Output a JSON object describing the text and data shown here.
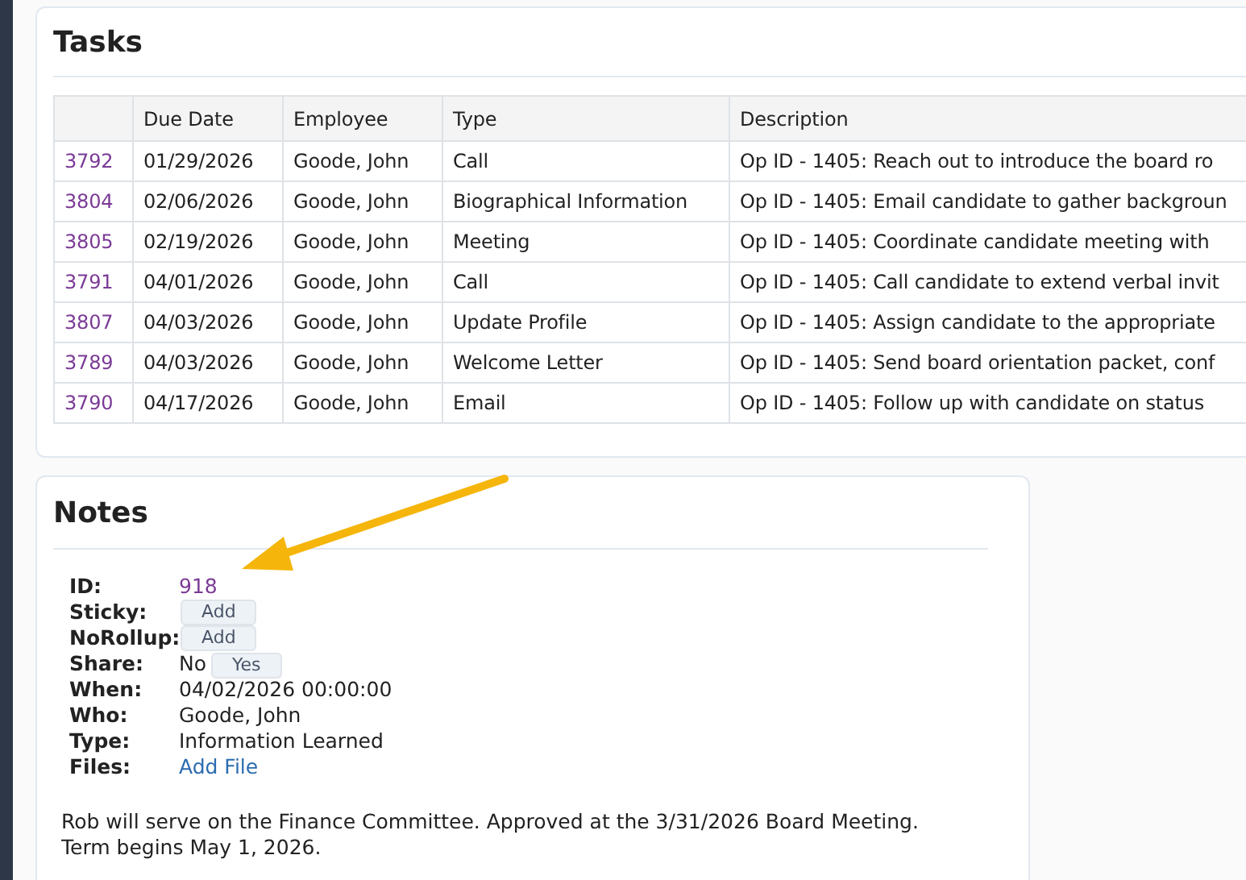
{
  "tasks": {
    "title": "Tasks",
    "columns": [
      "Due Date",
      "Employee",
      "Type",
      "Description"
    ],
    "rows": [
      {
        "id": "3792",
        "due_date": "01/29/2026",
        "employee": "Goode, John",
        "type": "Call",
        "description": "Op ID - 1405: Reach out to introduce the board ro"
      },
      {
        "id": "3804",
        "due_date": "02/06/2026",
        "employee": "Goode, John",
        "type": "Biographical Information",
        "description": "Op ID - 1405: Email candidate to gather backgroun"
      },
      {
        "id": "3805",
        "due_date": "02/19/2026",
        "employee": "Goode, John",
        "type": "Meeting",
        "description": "Op ID - 1405: Coordinate candidate meeting with"
      },
      {
        "id": "3791",
        "due_date": "04/01/2026",
        "employee": "Goode, John",
        "type": "Call",
        "description": "Op ID - 1405: Call candidate to extend verbal invit"
      },
      {
        "id": "3807",
        "due_date": "04/03/2026",
        "employee": "Goode, John",
        "type": "Update Profile",
        "description": "Op ID - 1405: Assign candidate to the appropriate"
      },
      {
        "id": "3789",
        "due_date": "04/03/2026",
        "employee": "Goode, John",
        "type": "Welcome Letter",
        "description": "Op ID - 1405: Send board orientation packet, conf"
      },
      {
        "id": "3790",
        "due_date": "04/17/2026",
        "employee": "Goode, John",
        "type": "Email",
        "description": "Op ID - 1405: Follow up with candidate on status"
      }
    ]
  },
  "notes": {
    "title": "Notes",
    "fields": [
      {
        "label": "ID:",
        "kind": "id_link",
        "value": "918"
      },
      {
        "label": "Sticky:",
        "kind": "button",
        "button": "Add"
      },
      {
        "label": "NoRollup:",
        "kind": "button",
        "button": "Add"
      },
      {
        "label": "Share:",
        "kind": "text_button",
        "value": "No",
        "button": "Yes"
      },
      {
        "label": "When:",
        "kind": "text",
        "value": "04/02/2026 00:00:00"
      },
      {
        "label": "Who:",
        "kind": "text",
        "value": "Goode, John"
      },
      {
        "label": "Type:",
        "kind": "text",
        "value": "Information Learned"
      },
      {
        "label": "Files:",
        "kind": "action_link",
        "value": "Add File"
      }
    ],
    "body": [
      "Rob will serve on the Finance Committee. Approved at the 3/31/2026 Board Meeting.",
      "Term begins May 1, 2026."
    ]
  }
}
